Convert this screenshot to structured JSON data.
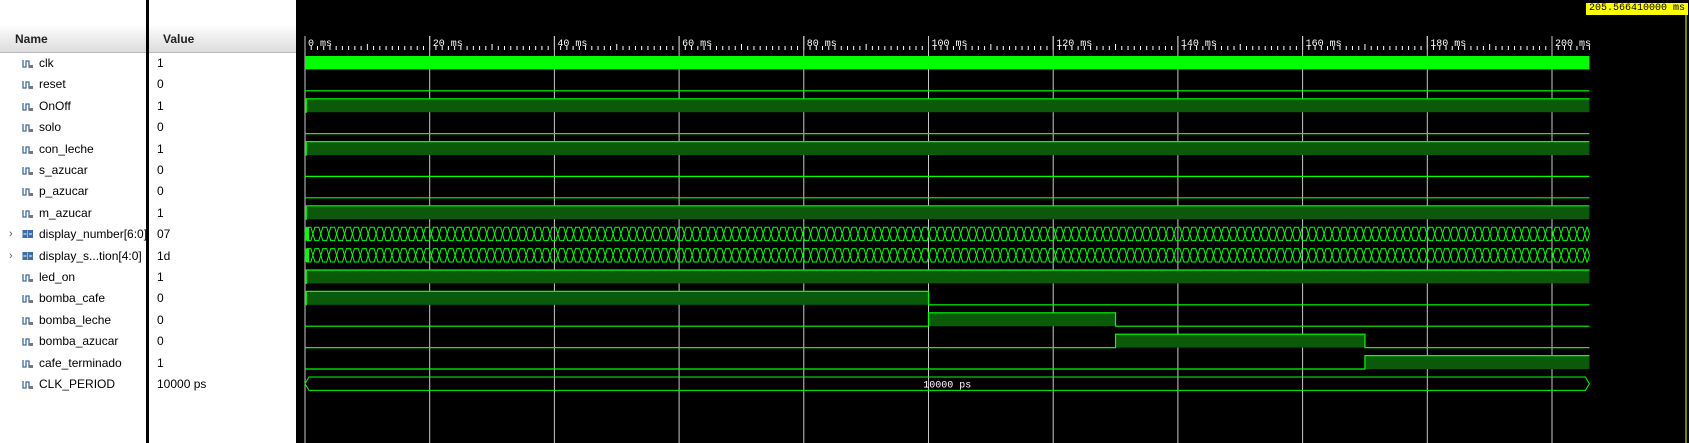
{
  "columns": {
    "name": "Name",
    "value": "Value"
  },
  "cursor_time": "205.566410000 ms",
  "time_ticks": [
    "0 ms",
    "20 ms",
    "40 ms",
    "60 ms",
    "80 ms",
    "100 ms",
    "120 ms",
    "140 ms",
    "160 ms",
    "180 ms",
    "200 ms"
  ],
  "timeline_ms": {
    "start": 0,
    "end": 206
  },
  "colors": {
    "wave": "#00ff00",
    "high_fill": "#0a5a0a",
    "grid": "#c8c8c8",
    "cursor_bg": "#ffff00"
  },
  "signals": [
    {
      "name": "clk",
      "value": "1",
      "kind": "clock",
      "icon": "logic-signal-icon"
    },
    {
      "name": "reset",
      "value": "0",
      "kind": "bit",
      "icon": "logic-signal-icon",
      "high": []
    },
    {
      "name": "OnOff",
      "value": "1",
      "kind": "bit",
      "icon": "logic-signal-icon",
      "high": [
        [
          0.2,
          206
        ]
      ]
    },
    {
      "name": "solo",
      "value": "0",
      "kind": "bit",
      "icon": "logic-signal-icon",
      "high": []
    },
    {
      "name": "con_leche",
      "value": "1",
      "kind": "bit",
      "icon": "logic-signal-icon",
      "high": [
        [
          0.2,
          206
        ]
      ]
    },
    {
      "name": "s_azucar",
      "value": "0",
      "kind": "bit",
      "icon": "logic-signal-icon",
      "high": []
    },
    {
      "name": "p_azucar",
      "value": "0",
      "kind": "bit",
      "icon": "logic-signal-icon",
      "high": []
    },
    {
      "name": "m_azucar",
      "value": "1",
      "kind": "bit",
      "icon": "logic-signal-icon",
      "high": [
        [
          0.2,
          206
        ]
      ]
    },
    {
      "name": "display_number[6:0]",
      "value": "07",
      "kind": "bus",
      "icon": "bus-signal-icon",
      "expandable": true
    },
    {
      "name": "display_s...tion[4:0]",
      "value": "1d",
      "kind": "bus",
      "icon": "bus-signal-icon",
      "expandable": true
    },
    {
      "name": "led_on",
      "value": "1",
      "kind": "bit",
      "icon": "logic-signal-icon",
      "high": [
        [
          0.2,
          206
        ]
      ]
    },
    {
      "name": "bomba_cafe",
      "value": "0",
      "kind": "bit",
      "icon": "logic-signal-icon",
      "high": [
        [
          0.2,
          100
        ]
      ]
    },
    {
      "name": "bomba_leche",
      "value": "0",
      "kind": "bit",
      "icon": "logic-signal-icon",
      "high": [
        [
          100,
          130
        ]
      ]
    },
    {
      "name": "bomba_azucar",
      "value": "0",
      "kind": "bit",
      "icon": "logic-signal-icon",
      "high": [
        [
          130,
          170
        ]
      ]
    },
    {
      "name": "cafe_terminado",
      "value": "1",
      "kind": "bit",
      "icon": "logic-signal-icon",
      "high": [
        [
          170,
          206
        ]
      ]
    },
    {
      "name": "CLK_PERIOD",
      "value": "10000 ps",
      "kind": "const",
      "icon": "logic-signal-icon",
      "label": "10000 ps"
    }
  ]
}
